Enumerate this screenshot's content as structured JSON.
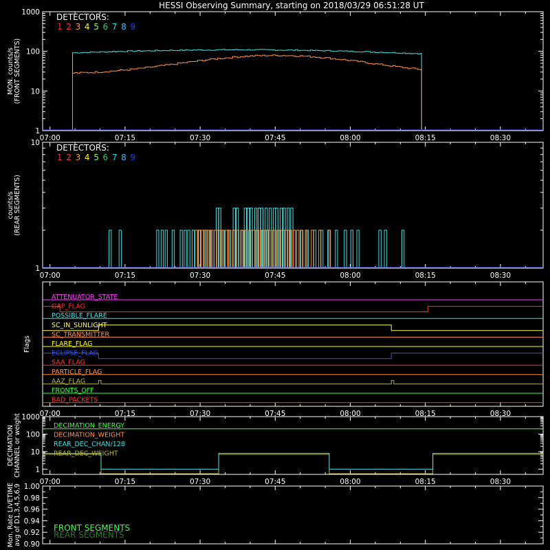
{
  "title": "HESSI Observing Summary, starting on 2018/03/29 06:51:28 UT",
  "colors": {
    "background": "#000000",
    "axes": "#ffffff",
    "det1": "#ff3030",
    "det2": "#ff3030",
    "det3": "#ff9a40",
    "det4": "#ffff00",
    "det5": "#80ff40",
    "det6": "#20d070",
    "det7": "#00e0e0",
    "det8": "#30c0ff",
    "det9": "#2040ff",
    "front_rate": "#40e0e0",
    "rear_rate": "#ff9040"
  },
  "time_axis": {
    "range_minutes": [
      -1.47,
      98.53
    ],
    "tick_labels": [
      "07:00",
      "07:15",
      "07:30",
      "07:45",
      "08:00",
      "08:15",
      "08:30"
    ],
    "tick_minutes": [
      0,
      15,
      30,
      45,
      60,
      75,
      90
    ]
  },
  "detector_legend": {
    "title": "DETECTORS:",
    "numbers": [
      "1",
      "2",
      "3",
      "4",
      "5",
      "6",
      "7",
      "8",
      "9"
    ]
  },
  "chart_data": [
    {
      "type": "line",
      "panel": "front",
      "ylabel": "MON. counts/s",
      "ylabel2": "(FRONT SEGMENTS)",
      "yscale": "log",
      "ylim": [
        1,
        1000
      ],
      "ytick_labels": [
        "1",
        "10",
        "100",
        "1000"
      ],
      "x_start": "07:04:30",
      "x_end": "08:14:15",
      "series": [
        {
          "color_key": "front_rate",
          "values_early": 95,
          "values_mid": 112,
          "values_late": 88
        },
        {
          "color_key": "rear_rate",
          "values_early": 35,
          "values_peak": 80,
          "values_late": 27
        }
      ]
    },
    {
      "type": "line",
      "panel": "rear",
      "ylabel": "counts/s",
      "ylabel2": "(REAR SEGMENTS)",
      "yscale": "log",
      "ylim": [
        1,
        10
      ],
      "ytick_labels": [
        "1",
        "10"
      ]
    },
    {
      "type": "table",
      "panel": "flags",
      "ylabel": "Flags",
      "flags": [
        {
          "label": "ATTENUATOR_STATE",
          "color": "#ff40ff"
        },
        {
          "label": "GAP_FLAG",
          "color": "#ff3030"
        },
        {
          "label": "POSSIBLE_FLARE",
          "color": "#40e0e0"
        },
        {
          "label": "SC_IN_SUNLIGHT",
          "color": "#ffff60"
        },
        {
          "label": "SC_TRANSMITTER",
          "color": "#ff9040"
        },
        {
          "label": "FLARE_FLAG",
          "color": "#ffff00"
        },
        {
          "label": "ECLIPSE_FLAG",
          "color": "#3050ff"
        },
        {
          "label": "SAA_FLAG",
          "color": "#ff3030"
        },
        {
          "label": "PARTICLE_FLAG",
          "color": "#ff9040"
        },
        {
          "label": "AAZ_FLAG",
          "color": "#b0b040"
        },
        {
          "label": "FRONTS_OFF",
          "color": "#40ff40"
        },
        {
          "label": "BAD_PACKETS",
          "color": "#ff3030"
        }
      ]
    },
    {
      "type": "line",
      "panel": "decimation",
      "ylabel": "DECIMATION",
      "ylabel2": "CHANNEL or weight",
      "yscale": "log",
      "ylim": [
        0.5,
        1000
      ],
      "ytick_labels": [
        "1",
        "10",
        "100",
        "1000"
      ],
      "series": [
        {
          "name": "DECIMATION_ENERGY",
          "color": "#40ff40",
          "value": 200
        },
        {
          "name": "DECIMATION_WEIGHT",
          "color": "#ff9040",
          "value": 200
        },
        {
          "name": "REAR_DEC_CHAN/128",
          "color": "#40e0e0",
          "high": 8,
          "low": 1
        },
        {
          "name": "REAR_DEC_WEIGHT",
          "color": "#b0b040",
          "high": 8,
          "low": 0.5
        }
      ]
    },
    {
      "type": "line",
      "panel": "livetime",
      "ylabel": "Mon. Rate LIVETIME",
      "ylabel2": "avg of D1,3,4,5,6,9",
      "ylim": [
        0.9,
        1.0
      ],
      "ytick_labels": [
        "0.90",
        "0.92",
        "0.94",
        "0.96",
        "0.98",
        "1.00"
      ],
      "ytick_labels_full": [
        "0.90",
        "0.92",
        "0.94",
        "0.96",
        "0.98",
        "1.00"
      ],
      "series": [
        {
          "name": "FRONT SEGMENTS",
          "color": "#40ff40"
        },
        {
          "name": "REAR SEGMENTS",
          "color": "#208020"
        }
      ]
    }
  ]
}
